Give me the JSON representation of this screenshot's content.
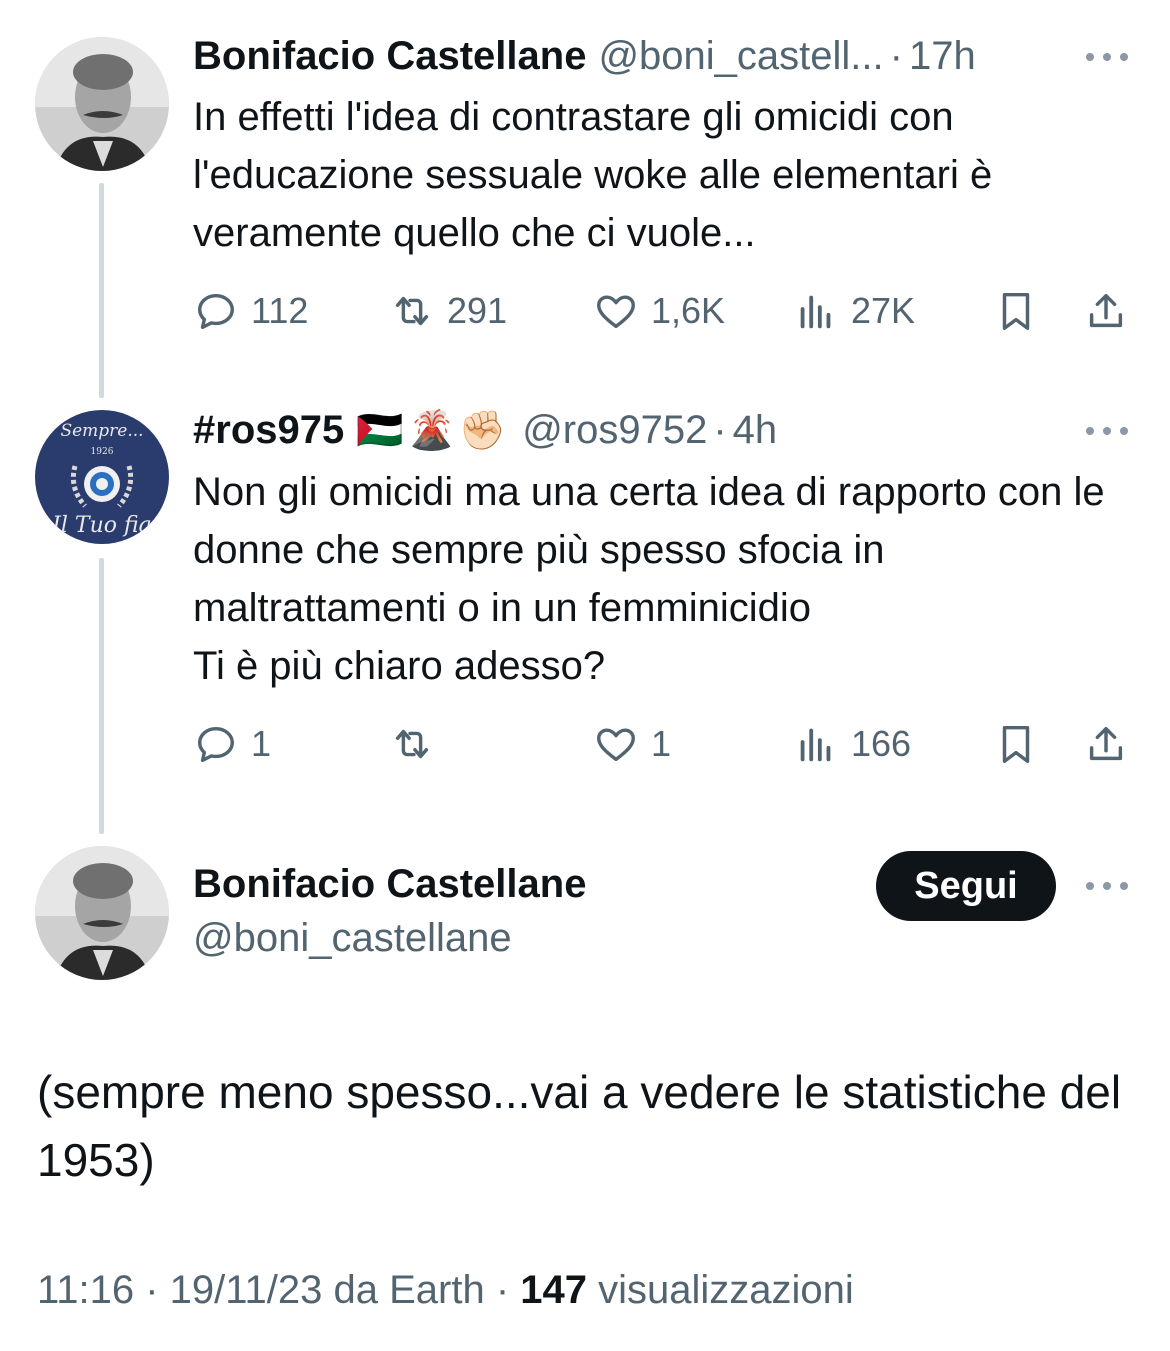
{
  "tweets": [
    {
      "name": "Bonifacio Castellane",
      "handle": "@boni_castell...",
      "time": "17h",
      "text": "In effetti l'idea di contrastare gli omicidi con l'educazione sessuale woke alle elementari è veramente quello che ci vuole...",
      "replies": "112",
      "retweets": "291",
      "likes": "1,6K",
      "views": "27K"
    },
    {
      "name": "#ros975",
      "emoji": "🇵🇸🌋✊🏻",
      "handle": "@ros9752",
      "time": "4h",
      "avatar_text_top": "Sempre...",
      "avatar_text_year": "1926",
      "avatar_text_bottom": "Il Tuo fia",
      "text": "Non gli omicidi ma una certa idea di rapporto con le donne che sempre più spesso sfocia in maltrattamenti o in un femminicidio\nTi è più chiaro adesso?",
      "replies": "1",
      "retweets": "",
      "likes": "1",
      "views": "166"
    }
  ],
  "main": {
    "name": "Bonifacio Castellane",
    "handle": "@boni_castellane",
    "follow_label": "Segui",
    "text": "(sempre meno spesso...vai a vedere le statistiche del 1953)",
    "time_date": "11:16 · 19/11/23 da Earth · ",
    "views_count": "147",
    "views_label": " visualizzazioni"
  },
  "separator": "·",
  "icons": [
    "reply-icon",
    "retweet-icon",
    "like-icon",
    "views-icon",
    "bookmark-icon",
    "share-icon",
    "more-icon"
  ]
}
